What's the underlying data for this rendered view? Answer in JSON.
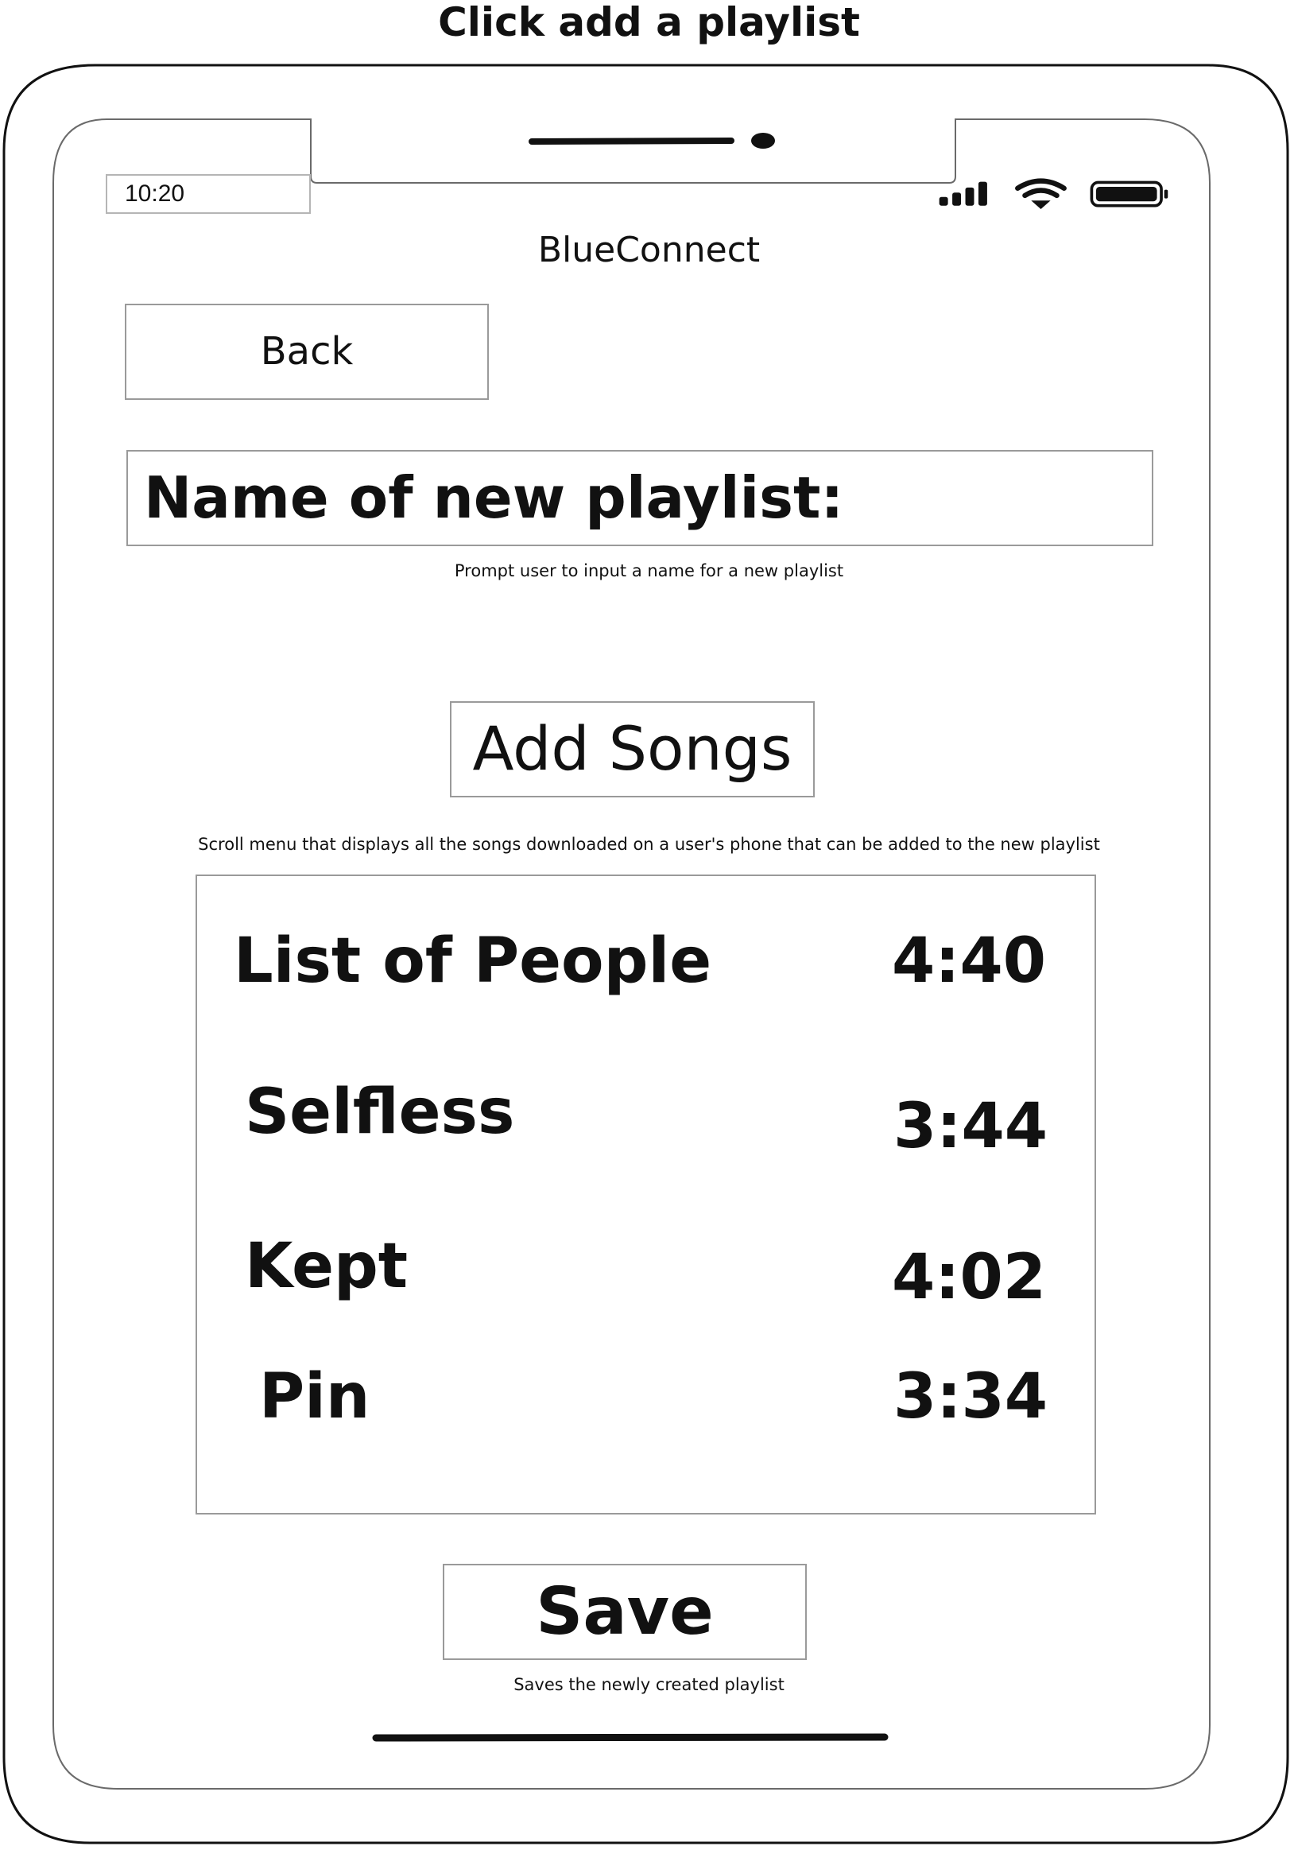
{
  "page_title": "Click add a playlist",
  "status_bar": {
    "time": "10:20",
    "icons": [
      "signal-bars-icon",
      "wifi-icon",
      "battery-icon"
    ]
  },
  "app": {
    "title": "BlueConnect"
  },
  "back_button": {
    "label": "Back"
  },
  "name_field": {
    "label": "Name of new playlist:",
    "note": "Prompt user to input a name for a new playlist"
  },
  "add_songs_button": {
    "label": "Add Songs",
    "note": "Scroll menu that displays all the songs downloaded on a user's phone that can be added to the new playlist"
  },
  "songs": [
    {
      "title": "List of People",
      "duration": "4:40"
    },
    {
      "title": "Selfless",
      "duration": "3:44"
    },
    {
      "title": "Kept",
      "duration": "4:02"
    },
    {
      "title": "Pin",
      "duration": "3:34"
    }
  ],
  "save_button": {
    "label": "Save",
    "note": "Saves the newly created playlist"
  }
}
